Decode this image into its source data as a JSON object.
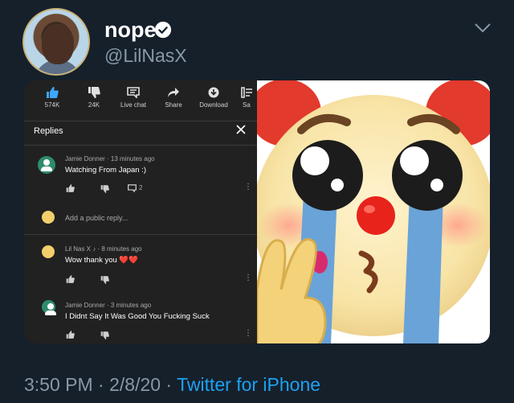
{
  "tweet": {
    "display_name": "nope",
    "handle": "@LilNasX",
    "timestamp": "3:50 PM · 2/8/20 · ",
    "source": "Twitter for iPhone"
  },
  "youtube": {
    "actions": [
      {
        "label": "574K",
        "icon": "thumbs-up-icon"
      },
      {
        "label": "24K",
        "icon": "thumbs-down-icon"
      },
      {
        "label": "Live chat",
        "icon": "chat-icon"
      },
      {
        "label": "Share",
        "icon": "share-icon"
      },
      {
        "label": "Download",
        "icon": "download-icon"
      },
      {
        "label": "Sa",
        "icon": "save-icon"
      }
    ],
    "replies_title": "Replies",
    "comments": [
      {
        "author_meta": "Jamie Donner · 13 minutes ago",
        "text": "Watching From Japan :)",
        "reply_count": "2"
      },
      {
        "author_meta": "Lil Nas X ♪ · 8 minutes ago",
        "text": "Wow thank you ❤️❤️"
      },
      {
        "author_meta": "Jamie Donner · 3 minutes ago",
        "text": "I Didnt Say It Was Good You Fucking Suck"
      }
    ],
    "add_reply_placeholder": "Add a public reply...",
    "colors": {
      "thumb_active": "#3ea6ff",
      "panel_bg": "#212121",
      "avatar_green": "#2e8c6a"
    }
  },
  "emoji": {
    "name": "pleading-clown-face-emoji"
  }
}
